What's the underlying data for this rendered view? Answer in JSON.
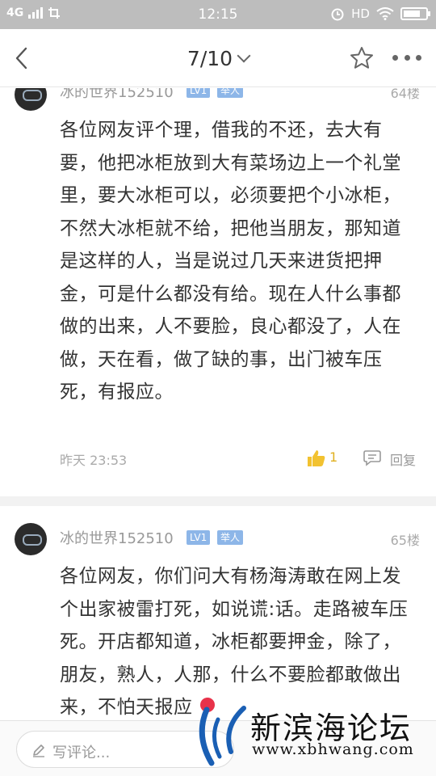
{
  "status_bar": {
    "network": "4G",
    "time": "12:15",
    "hd": "HD",
    "icons": [
      "signal-icon",
      "screenshot-icon",
      "alarm-icon",
      "wifi-icon",
      "battery-icon"
    ]
  },
  "header": {
    "page_indicator": "7/10",
    "icons": [
      "back-arrow-icon",
      "chevron-down-icon",
      "star-icon",
      "more-icon"
    ]
  },
  "posts": [
    {
      "username": "冰的世界152510",
      "level": "LV1",
      "role": "举人",
      "floor": "64楼",
      "text": "各位网友评个理，借我的不还，去大有要，他把冰柜放到大有菜场边上一个礼堂里，要大冰柜可以，必须要把个小冰柜，不然大冰柜就不给，把他当朋友，那知道是这样的人，当是说过几天来进货把押金，可是什么都没有给。现在人什么事都做的出来，人不要脸，良心都没了，人在做，天在看，做了缺的事，出门被车压死，有报应。",
      "time": "昨天 23:53",
      "likes": "1",
      "reply_label": "回复"
    },
    {
      "username": "冰的世界152510",
      "level": "LV1",
      "role": "举人",
      "floor": "65楼",
      "text": "各位网友，你们问大有杨海涛敢在网上发个出家被雷打死，如说谎:话。走路被车压死。开店都知道，冰柜都要押金，除了，朋友，熟人，人那，什么不要脸都敢做出来，不怕天报应"
    }
  ],
  "bottom_bar": {
    "comment_placeholder": "写评论..."
  },
  "watermark": {
    "title": "新滨海论坛",
    "url": "www.xbhwang.com"
  },
  "colors": {
    "status_bar_bg": "#bdbdbd",
    "badge_bg": "#8db6e8",
    "like_color": "#e0b020",
    "divider": "#f2f2f2",
    "watermark_blue": "#1a5fb4"
  }
}
